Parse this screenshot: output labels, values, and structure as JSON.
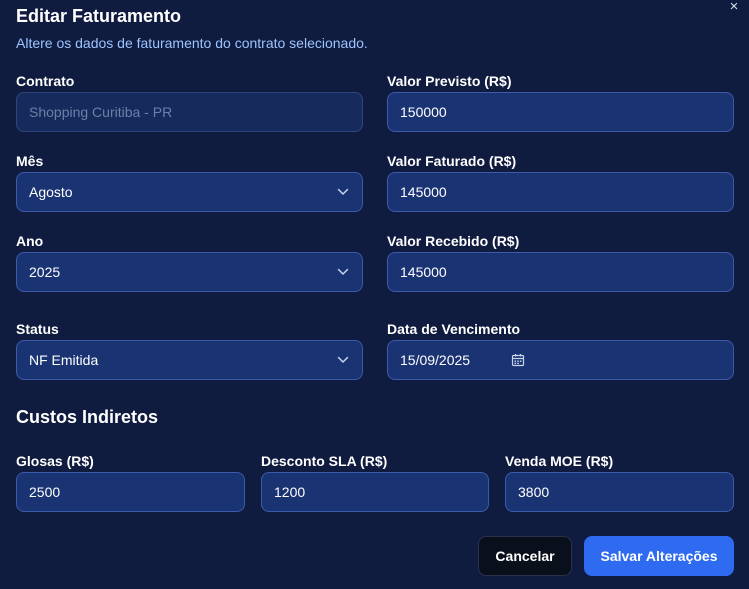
{
  "header": {
    "title": "Editar Faturamento",
    "subtitle": "Altere os dados de faturamento do contrato selecionado.",
    "close_icon": "×"
  },
  "form": {
    "contrato": {
      "label": "Contrato",
      "value": "Shopping Curitiba - PR"
    },
    "valor_previsto": {
      "label": "Valor Previsto (R$)",
      "value": "150000"
    },
    "mes": {
      "label": "Mês",
      "value": "Agosto"
    },
    "valor_faturado": {
      "label": "Valor Faturado (R$)",
      "value": "145000"
    },
    "ano": {
      "label": "Ano",
      "value": "2025"
    },
    "valor_recebido": {
      "label": "Valor Recebido (R$)",
      "value": "145000"
    },
    "status": {
      "label": "Status",
      "value": "NF Emitida"
    },
    "data_vencimento": {
      "label": "Data de Vencimento",
      "value": "15/09/2025"
    }
  },
  "custos": {
    "title": "Custos Indiretos",
    "glosas": {
      "label": "Glosas (R$)",
      "value": "2500"
    },
    "desconto_sla": {
      "label": "Desconto SLA (R$)",
      "value": "1200"
    },
    "venda_moe": {
      "label": "Venda MOE (R$)",
      "value": "3800"
    }
  },
  "actions": {
    "cancel_label": "Cancelar",
    "save_label": "Salvar Alterações"
  },
  "colors": {
    "background": "#0f1b3f",
    "field_bg": "#1a3372",
    "accent": "#2f6bf0",
    "subtitle": "#9cc4ff"
  },
  "icons": {
    "close": "close-icon",
    "dropdown": "chevron-down-icon",
    "date": "calendar-icon"
  }
}
